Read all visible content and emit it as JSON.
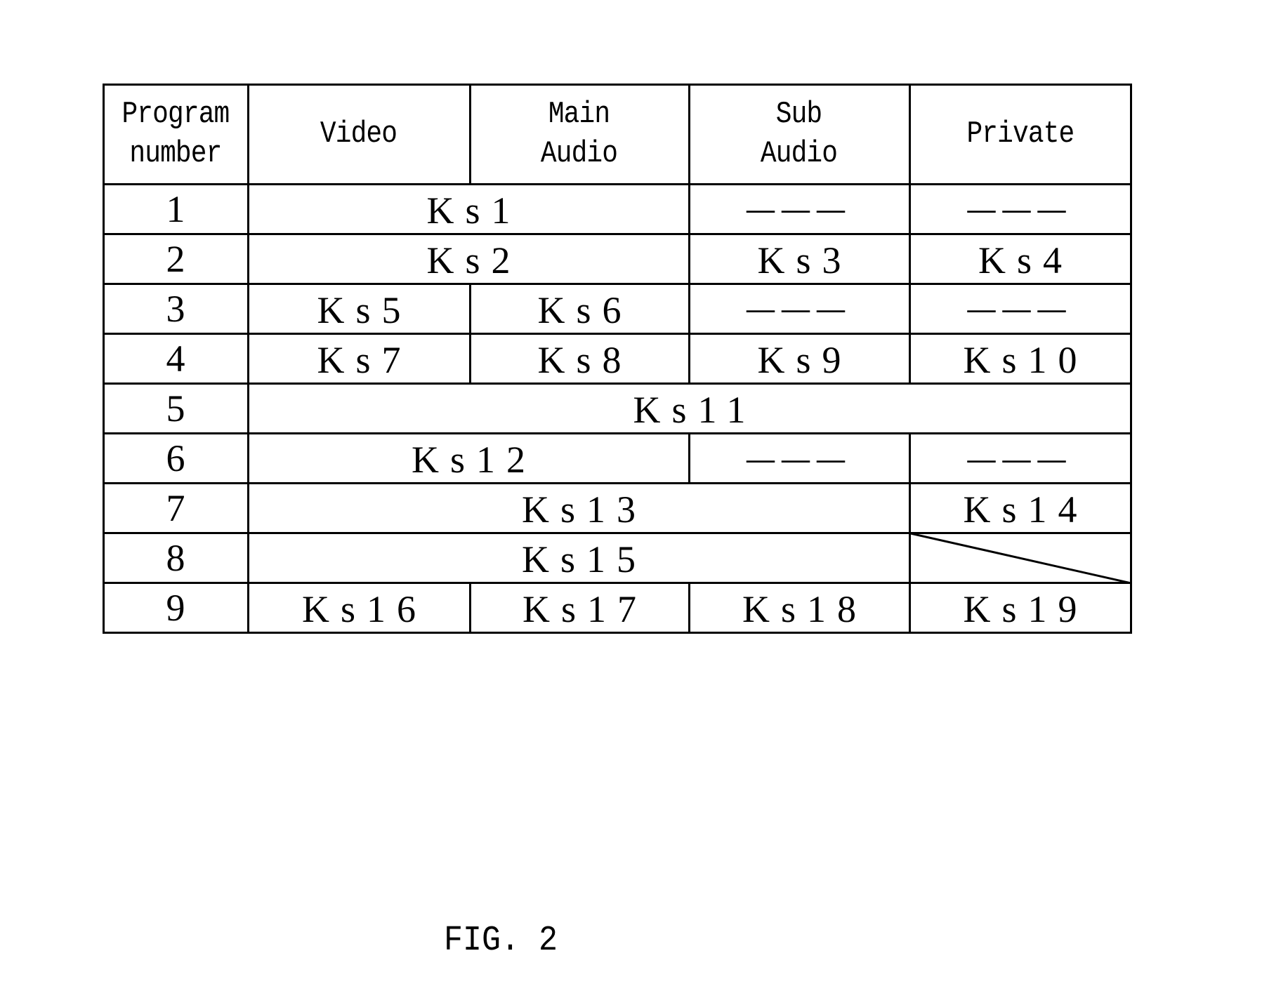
{
  "figure": {
    "caption": "FIG. 2",
    "columns": [
      "Program\nnumber",
      "Video",
      "Main\nAudio",
      "Sub\nAudio",
      "Private"
    ],
    "rows": [
      {
        "program": "1",
        "cells": [
          {
            "text": "Ks1",
            "span": [
              "Video",
              "Main Audio"
            ]
          },
          {
            "text": "---",
            "span": [
              "Sub Audio"
            ]
          },
          {
            "text": "---",
            "span": [
              "Private"
            ]
          }
        ]
      },
      {
        "program": "2",
        "cells": [
          {
            "text": "Ks2",
            "span": [
              "Video",
              "Main Audio"
            ]
          },
          {
            "text": "Ks3",
            "span": [
              "Sub Audio"
            ]
          },
          {
            "text": "Ks4",
            "span": [
              "Private"
            ]
          }
        ]
      },
      {
        "program": "3",
        "cells": [
          {
            "text": "Ks5",
            "span": [
              "Video"
            ]
          },
          {
            "text": "Ks6",
            "span": [
              "Main Audio"
            ]
          },
          {
            "text": "---",
            "span": [
              "Sub Audio"
            ]
          },
          {
            "text": "---",
            "span": [
              "Private"
            ]
          }
        ]
      },
      {
        "program": "4",
        "cells": [
          {
            "text": "Ks7",
            "span": [
              "Video"
            ]
          },
          {
            "text": "Ks8",
            "span": [
              "Main Audio"
            ]
          },
          {
            "text": "Ks9",
            "span": [
              "Sub Audio"
            ]
          },
          {
            "text": "Ks10",
            "span": [
              "Private"
            ]
          }
        ]
      },
      {
        "program": "5",
        "cells": [
          {
            "text": "Ks11",
            "span": [
              "Video",
              "Main Audio",
              "Sub Audio",
              "Private"
            ]
          }
        ]
      },
      {
        "program": "6",
        "cells": [
          {
            "text": "Ks12",
            "span": [
              "Video",
              "Main Audio"
            ]
          },
          {
            "text": "---",
            "span": [
              "Sub Audio"
            ]
          },
          {
            "text": "---",
            "span": [
              "Private"
            ]
          }
        ]
      },
      {
        "program": "7",
        "cells": [
          {
            "text": "Ks13",
            "span": [
              "Video",
              "Main Audio",
              "Sub Audio"
            ]
          },
          {
            "text": "Ks14",
            "span": [
              "Private"
            ]
          }
        ]
      },
      {
        "program": "8",
        "cells": [
          {
            "text": "Ks15",
            "span": [
              "Video",
              "Main Audio",
              "Sub Audio"
            ]
          },
          {
            "text": "",
            "span": [
              "Private"
            ],
            "not_applicable": true
          }
        ]
      },
      {
        "program": "9",
        "cells": [
          {
            "text": "Ks16",
            "span": [
              "Video"
            ]
          },
          {
            "text": "Ks17",
            "span": [
              "Main Audio"
            ]
          },
          {
            "text": "Ks18",
            "span": [
              "Sub Audio"
            ]
          },
          {
            "text": "Ks19",
            "span": [
              "Private"
            ]
          }
        ]
      }
    ]
  }
}
